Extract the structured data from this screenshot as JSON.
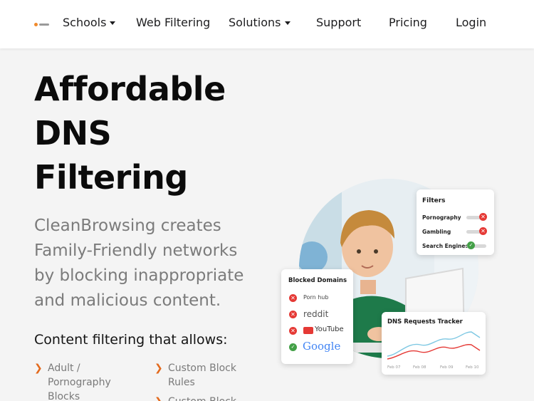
{
  "nav": {
    "items": [
      {
        "label": "Schools",
        "dropdown": true
      },
      {
        "label": "Web Filtering",
        "dropdown": false
      },
      {
        "label": "Solutions",
        "dropdown": true
      },
      {
        "label": "Support",
        "dropdown": false
      },
      {
        "label": "Pricing",
        "dropdown": false
      },
      {
        "label": "Login",
        "dropdown": false
      }
    ]
  },
  "hero": {
    "title_lines": [
      "Affordable",
      "DNS",
      "Filtering"
    ],
    "subtitle_lines": [
      "CleanBrowsing creates",
      "Family-Friendly networks",
      "by blocking inappropriate",
      "and malicious content."
    ],
    "allows_heading": "Content filtering that allows:"
  },
  "features": [
    {
      "lines": [
        "Adult /",
        "Pornography",
        "Blocks"
      ]
    },
    {
      "lines": [
        "Custom Block",
        "Rules"
      ]
    },
    {
      "lines": [
        "Custom Block"
      ]
    }
  ],
  "filters_card": {
    "title": "Filters",
    "rows": [
      {
        "label": "Pornography",
        "state": "blocked"
      },
      {
        "label": "Gambling",
        "state": "blocked"
      },
      {
        "label": "Search Engines",
        "state": "allowed"
      }
    ]
  },
  "blocked_card": {
    "title": "Blocked Domains",
    "rows": [
      {
        "label": "Porn hub",
        "state": "blocked"
      },
      {
        "label": "reddit",
        "state": "blocked"
      },
      {
        "label": "YouTube",
        "state": "blocked"
      },
      {
        "label": "Google",
        "state": "allowed"
      }
    ]
  },
  "tracker_card": {
    "title": "DNS Requests Tracker",
    "dates": [
      "Feb 07",
      "Feb 08",
      "Feb 09",
      "Feb 10"
    ]
  },
  "colors": {
    "accent": "#e3691c",
    "blocked": "#e53935",
    "allowed": "#43a047",
    "line_blue": "#7ec8e3",
    "line_red": "#e53935"
  }
}
